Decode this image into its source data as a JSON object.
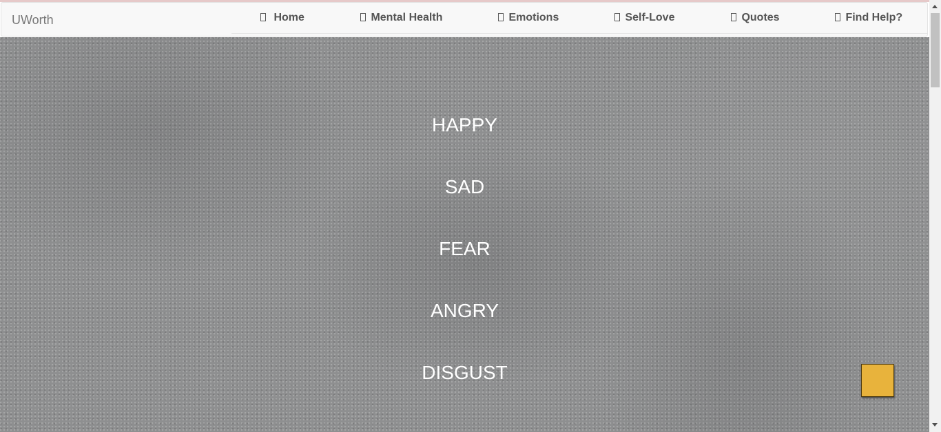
{
  "brand": "UWorth",
  "nav": [
    {
      "label": "Home",
      "name": "nav-home"
    },
    {
      "label": "Mental Health",
      "name": "nav-mental-health"
    },
    {
      "label": "Emotions",
      "name": "nav-emotions"
    },
    {
      "label": "Self-Love",
      "name": "nav-self-love"
    },
    {
      "label": "Quotes",
      "name": "nav-quotes"
    },
    {
      "label": "Find Help?",
      "name": "nav-find-help"
    }
  ],
  "emotions": [
    "HAPPY",
    "SAD",
    "FEAR",
    "ANGRY",
    "DISGUST"
  ],
  "colors": {
    "nav_bg": "#f8f8f8",
    "hero_bg": "#8e8f90",
    "back_to_top": "#e8b33c"
  }
}
